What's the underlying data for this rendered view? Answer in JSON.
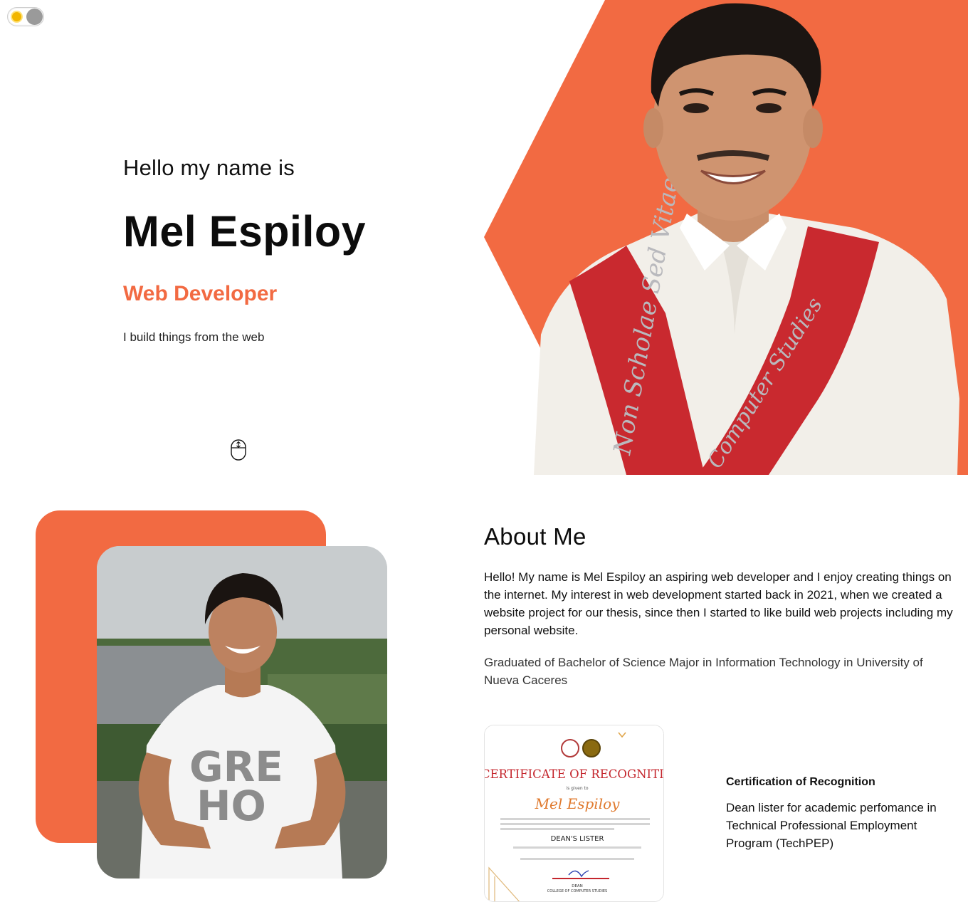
{
  "theme_toggle": {
    "icon": "sun-icon",
    "state": "light"
  },
  "hero": {
    "greeting": "Hello my name is",
    "name": "Mel Espiloy",
    "role": "Web Developer",
    "tagline": "I build things from the web",
    "scroll_icon": "mouse-scroll-icon",
    "sash_text_left": "Non Scholae Sed Vitae",
    "sash_text_right": "Computer Studies"
  },
  "about": {
    "title": "About Me",
    "paragraph": "Hello! My name is Mel Espiloy an aspiring web developer and I enjoy creating things on the internet. My interest in web development started back in 2021, when we created a website project for our thesis, since then I started to like build web projects including my personal website.",
    "education": "Graduated of Bachelor of Science Major in Information Technology in University of Nueva Caceres"
  },
  "certificate": {
    "image": {
      "heading": "CERTIFICATE OF RECOGNITIO",
      "given_to": "is given to",
      "recipient": "Mel Espiloy",
      "award": "DEAN'S LISTER",
      "signatory_title": "DEAN",
      "signatory_org": "COLLEGE OF COMPUTER STUDIES"
    },
    "title": "Certification of Recognition",
    "description": "Dean lister for academic perfomance in Technical Professional Employment Program (TechPEP)"
  },
  "colors": {
    "accent": "#f26a42",
    "text": "#111111",
    "background": "#ffffff"
  }
}
